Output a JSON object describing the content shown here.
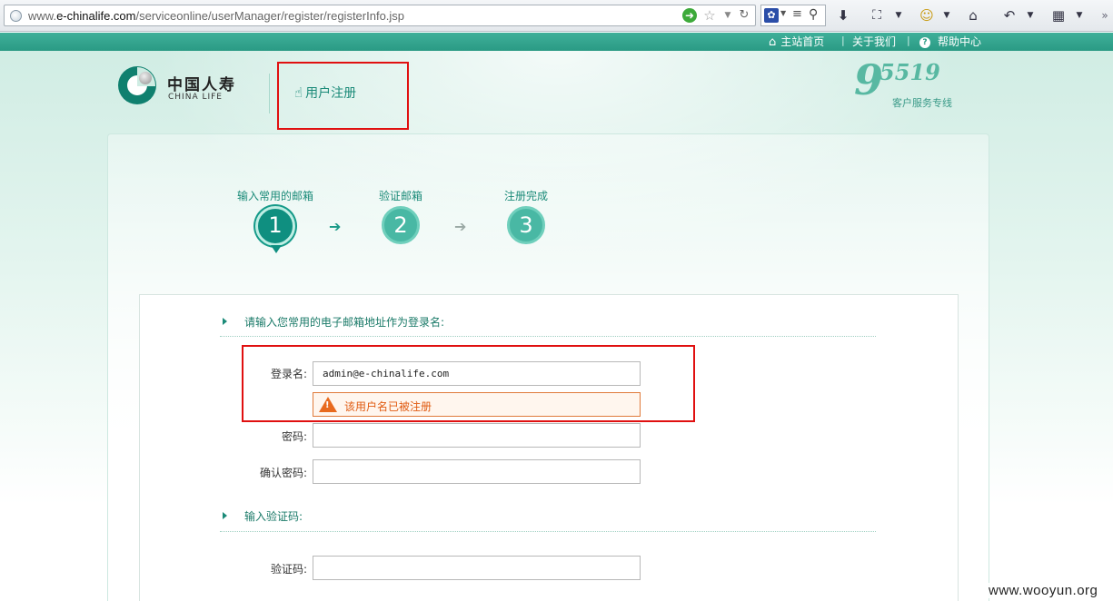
{
  "browser": {
    "url_prefix": "www.",
    "url_domain": "e-chinalife.com",
    "url_path": "/serviceonline/userManager/register/registerInfo.jsp",
    "go_icon": "green-go-arrow",
    "search_engine_icon": "paw-icon"
  },
  "top_nav": {
    "home": "主站首页",
    "about": "关于我们",
    "help": "帮助中心",
    "separator": "|"
  },
  "header": {
    "logo_cn": "中国人寿",
    "logo_en": "CHINA LIFE",
    "register_title": "用户注册",
    "hotline_number_big": "9",
    "hotline_number_small": "5519",
    "hotline_label": "客户服务专线"
  },
  "steps": [
    {
      "label": "输入常用的邮箱",
      "number": "1",
      "active": true
    },
    {
      "label": "验证邮箱",
      "number": "2",
      "active": false
    },
    {
      "label": "注册完成",
      "number": "3",
      "active": false
    }
  ],
  "form": {
    "section_email": "请输入您常用的电子邮箱地址作为登录名:",
    "username_label": "登录名:",
    "username_value": "admin@e-chinalife.com",
    "error_message": "该用户名已被注册",
    "password_label": "密码:",
    "confirm_label": "确认密码:",
    "section_captcha": "输入验证码:",
    "captcha_label": "验证码:"
  },
  "colors": {
    "brand_teal": "#1a8a78",
    "nav_bar": "#2a9a84",
    "error_orange": "#e05a10",
    "annotation_red": "#e01010"
  },
  "watermark": "www.wooyun.org"
}
